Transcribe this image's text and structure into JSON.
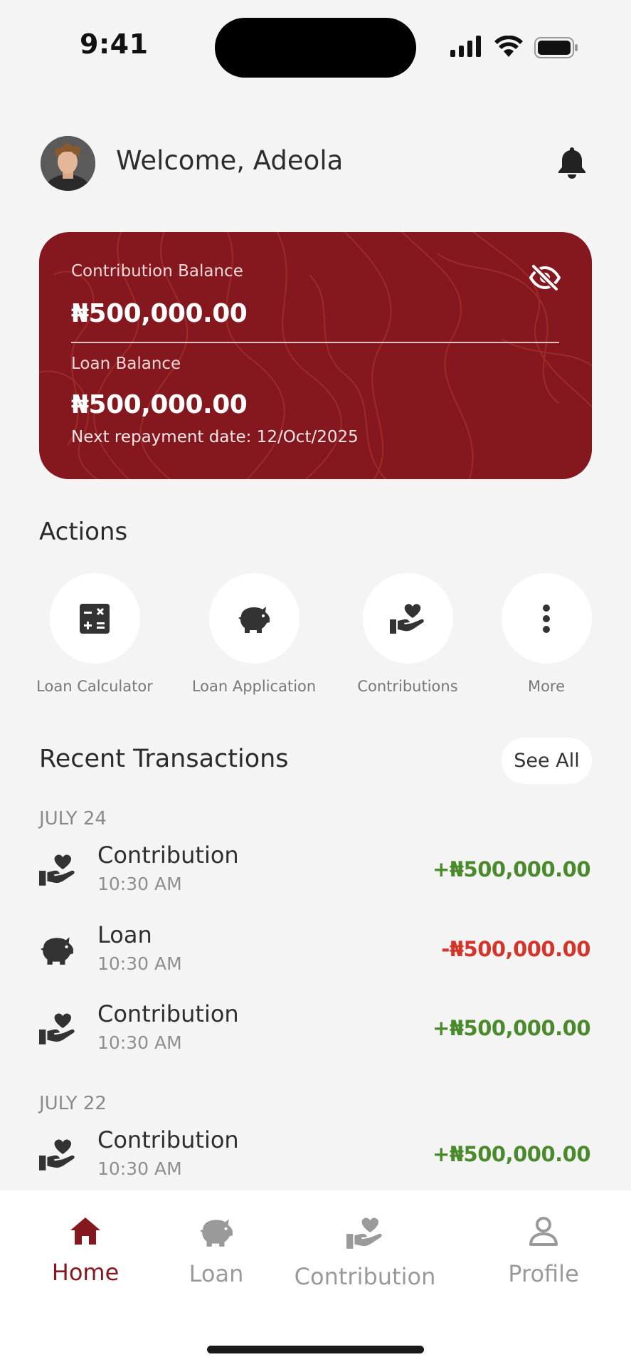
{
  "status_bar": {
    "time": "9:41"
  },
  "header": {
    "welcome": "Welcome, Adeola"
  },
  "balance_card": {
    "contribution_label": "Contribution Balance",
    "contribution_amount": "₦500,000.00",
    "loan_label": "Loan Balance",
    "loan_amount": "₦500,000.00",
    "next_repayment": "Next repayment date: 12/Oct/2025"
  },
  "actions": {
    "title": "Actions",
    "items": [
      {
        "label": "Loan Calculator",
        "icon": "calculator-icon"
      },
      {
        "label": "Loan Application",
        "icon": "piggy-bank-icon"
      },
      {
        "label": "Contributions",
        "icon": "hand-heart-icon"
      },
      {
        "label": "More",
        "icon": "more-vertical-icon"
      }
    ]
  },
  "transactions": {
    "title": "Recent Transactions",
    "see_all": "See All",
    "groups": [
      {
        "date": "JULY 24",
        "items": [
          {
            "type": "Contribution",
            "time": "10:30 AM",
            "amount": "+₦500,000.00",
            "icon": "hand-heart-icon"
          },
          {
            "type": "Loan",
            "time": "10:30 AM",
            "amount": "-₦500,000.00",
            "icon": "piggy-bank-icon"
          },
          {
            "type": "Contribution",
            "time": "10:30 AM",
            "amount": "+₦500,000.00",
            "icon": "hand-heart-icon"
          }
        ]
      },
      {
        "date": "JULY 22",
        "items": [
          {
            "type": "Contribution",
            "time": "10:30 AM",
            "amount": "+₦500,000.00",
            "icon": "hand-heart-icon"
          }
        ]
      }
    ]
  },
  "bottom_nav": {
    "items": [
      {
        "label": "Home",
        "icon": "home-icon",
        "active": true
      },
      {
        "label": "Loan",
        "icon": "piggy-bank-icon",
        "active": false
      },
      {
        "label": "Contribution",
        "icon": "hand-heart-icon",
        "active": false
      },
      {
        "label": "Profile",
        "icon": "user-icon",
        "active": false
      }
    ]
  },
  "colors": {
    "brand": "#85181e",
    "positive": "#4a8a2c",
    "negative": "#d3352b",
    "background": "#f4f4f4"
  }
}
